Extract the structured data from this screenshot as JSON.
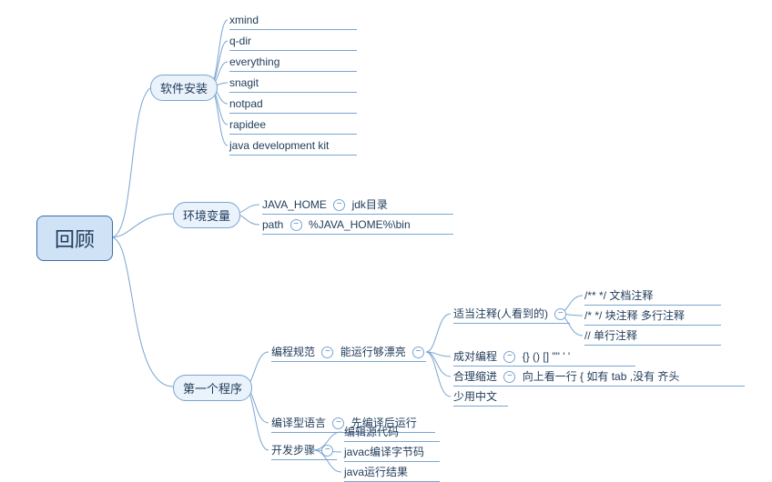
{
  "root": "回顾",
  "branch1": {
    "label": "软件安装",
    "items": [
      "xmind",
      "q-dir",
      "everything",
      "snagit",
      "notpad",
      "rapidee",
      "java development kit"
    ]
  },
  "branch2": {
    "label": "环境变量",
    "items": [
      {
        "k": "JAVA_HOME",
        "v": "jdk目录"
      },
      {
        "k": "path",
        "v": "%JAVA_HOME%\\bin"
      }
    ]
  },
  "branch3": {
    "label": "第一个程序",
    "spec": {
      "label": "编程规范",
      "sub": "能运行够漂亮",
      "comments": {
        "label": "适当注释(人看到的)",
        "items": [
          "/** */ 文档注释",
          "/* */ 块注释 多行注释",
          "// 单行注释"
        ]
      },
      "pair": {
        "label": "成对编程",
        "v": "{} () [] \"\" ' '"
      },
      "indent": {
        "label": "合理缩进",
        "v": "向上看一行 { 如有 tab ,没有 齐头"
      },
      "less_cn": "少用中文"
    },
    "compiled": {
      "label": "编译型语言",
      "v": "先编译后运行"
    },
    "steps": {
      "label": "开发步骤",
      "items": [
        "编辑源代码",
        "javac编译字节码",
        "java运行结果"
      ]
    }
  }
}
